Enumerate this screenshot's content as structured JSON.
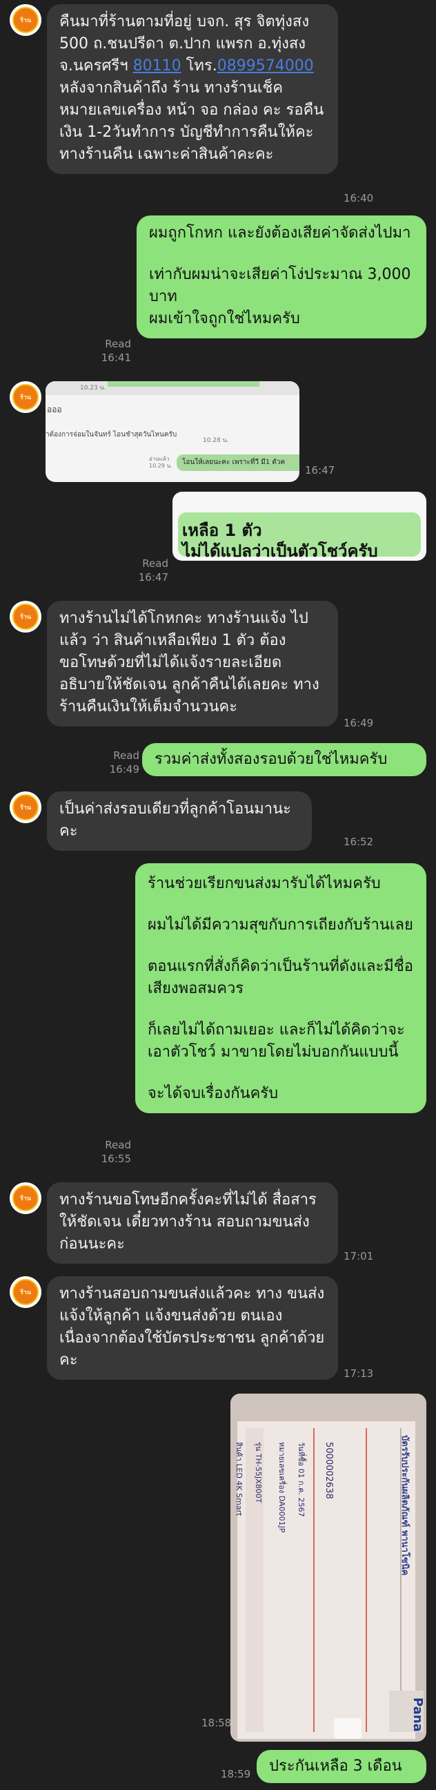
{
  "avatar_label": "ร้าน",
  "messages": {
    "m1": {
      "p1": "คืนมาที่ร้านตามที่อยู่ บจก. สุร จิตทุ่งสง 500 ถ.ชนปรีดา ต.ปาก แพรก อ.ทุ่งสง จ.นครศรีฯ ",
      "zip": "80110",
      "p2": "โทร.",
      "phone": "0899574000",
      "p3": " หลังจากสินค้าถึง ร้าน ทางร้านเช็คหมายเลขเครื่อง หน้า จอ กล่อง คะ รอคืนเงิน 1-2วันทำการ บัญชีทำการคืนให้คะ ทางร้านคืน เฉพาะค่าสินค้าคะคะ",
      "time": "16:40"
    },
    "m2": {
      "text1": "ผมถูกโกหก และยังต้องเสียค่าจัดส่งไปมา",
      "text2": "เท่ากับผมน่าจะเสียค่าโง่ประมาณ 3,000 บาท\nผมเข้าใจถูกใช่ไหมครับ",
      "read": "Read",
      "time": "16:41"
    },
    "m3": {
      "line1": "10.23 น.",
      "line2": "อออ",
      "line3": "ำต้องการจ่อมในจันทร์ ไอนชำสุดวันไหนครับ",
      "line4": "10.28 น.",
      "line5": "อ่านแล้ว 10.29 น.",
      "line6": "โอนให้เลยนะคะ เพราะที่วี มี1 ตัวค",
      "time": "16:47"
    },
    "m4": {
      "line1": "เหลือ 1 ตัว",
      "line2": "ไม่ได้แปลว่าเป็นตัวโชว์ครับ",
      "read": "Read",
      "time": "16:47"
    },
    "m5": {
      "text": "ทางร้านไม่ได้โกหกคะ ทางร้านแจ้ง ไปแล้ว ว่า สินค้าเหลือเพียง 1 ตัว ต้อง ขอโทษด้วยที่ไม่ได้แจ้งรายละเอียด อธิบายให้ชัดเจน ลูกค้าคืนได้เลยคะ ทางร้านคืนเงินให้เต็มจำนวนคะ",
      "time": "16:49"
    },
    "m6": {
      "text": "รวมค่าส่งทั้งสองรอบด้วยใช่ไหมครับ",
      "read": "Read",
      "time": "16:49"
    },
    "m7": {
      "text": "เป็นค่าส่งรอบเดียวที่ลูกค้าโอนมานะ คะ",
      "time": "16:52"
    },
    "m8": {
      "p1": "ร้านช่วยเรียกขนส่งมารับได้ไหมครับ",
      "p2": "ผมไม่ได้มีความสุขกับการเถียงกับร้านเลย",
      "p3": "ตอนแรกที่สั่งก็คิดว่าเป็นร้านที่ดังและมีชื่อเสียงพอสมควร",
      "p4": "ก็เลยไม่ได้ถามเยอะ และก็ไม่ได้คิดว่าจะเอาตัวโชว์ มาขายโดยไม่บอกกันแบบนี้",
      "p5": "จะได้จบเรื่องกันครับ",
      "read": "Read",
      "time": "16:55"
    },
    "m9": {
      "text": "ทางร้านขอโทษอีกครั้งคะที่ไม่ได้ สื่อสารให้ชัดเจน เดี๋ยวทางร้าน สอบถามขนส่งก่อนนะคะ",
      "time": "17:01"
    },
    "m10": {
      "text": "ทางร้านสอบถามขนส่งแล้วคะ ทาง ขนส่งแจ้งให้ลูกค้า แจ้งขนส่งด้วย ตนเองเนื่องจากต้องใช้บัตรประชาชน ลูกค้าด้วยคะ",
      "time": "17:13"
    },
    "m11": {
      "receipt_title": "บัตรรับประกันผลิตภัณฑ์ พานาโซนิค",
      "product": "สินค้า LED 4K Smart",
      "model": "รุ่น TH-55JX800T",
      "serial": "หมายเลขเครื่อง DA0001JP",
      "buy_date": "วันที่ซื้อ 01 ก.ค. 2567",
      "invoice": "5000002638",
      "brand": "Pana",
      "time": "18:58"
    },
    "m12": {
      "text": "ประกันเหลือ 3 เดือน",
      "time": "18:59"
    }
  }
}
